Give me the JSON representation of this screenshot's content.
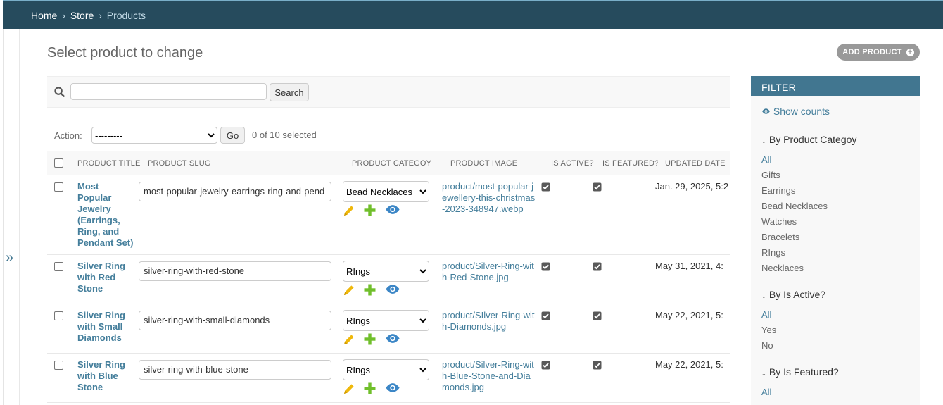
{
  "breadcrumbs": {
    "home": "Home",
    "sep1": "›",
    "store": "Store",
    "sep2": "›",
    "current": "Products"
  },
  "page": {
    "title": "Select product to change",
    "add_button": "ADD PRODUCT",
    "add_icon": "+"
  },
  "search": {
    "value": "",
    "placeholder": "",
    "button": "Search"
  },
  "actions": {
    "label": "Action:",
    "selected_option": "---------",
    "go": "Go",
    "selected_count": "0 of 10 selected"
  },
  "table": {
    "headers": {
      "title": "PRODUCT TITLE",
      "slug": "PRODUCT SLUG",
      "category": "PRODUCT CATEGOY",
      "image": "PRODUCT IMAGE",
      "active": "IS ACTIVE?",
      "featured": "IS FEATURED?",
      "updated": "UPDATED DATE"
    },
    "rows": [
      {
        "title": "Most Popular Jewelry (Earrings, Ring, and Pendant Set)",
        "slug": "most-popular-jewelry-earrings-ring-and-pend",
        "category": "Bead Necklaces",
        "image": "product/most-popular-jewellery-this-christmas-2023-348947.webp",
        "is_active": true,
        "is_featured": true,
        "updated": "Jan. 29, 2025, 5:2"
      },
      {
        "title": "Silver Ring with Red Stone",
        "slug": "silver-ring-with-red-stone",
        "category": "RIngs",
        "image": "product/Silver-Ring-with-Red-Stone.jpg",
        "is_active": true,
        "is_featured": true,
        "updated": "May 31, 2021, 4:"
      },
      {
        "title": "Silver Ring with Small Diamonds",
        "slug": "silver-ring-with-small-diamonds",
        "category": "RIngs",
        "image": "product/SIlver-Ring-with-Diamonds.jpg",
        "is_active": true,
        "is_featured": true,
        "updated": "May 22, 2021, 5:"
      },
      {
        "title": "Silver Ring with Blue Stone",
        "slug": "silver-ring-with-blue-stone",
        "category": "RIngs",
        "image": "product/Silver-Ring-with-Blue-Stone-and-Diamonds.jpg",
        "is_active": true,
        "is_featured": true,
        "updated": "May 22, 2021, 5:"
      }
    ]
  },
  "filter": {
    "title": "FILTER",
    "show_counts": "Show counts",
    "sections": [
      {
        "title": "↓ By Product Categoy",
        "items": [
          "All",
          "Gifts",
          "Earrings",
          "Bead Necklaces",
          "Watches",
          "Bracelets",
          "RIngs",
          "Necklaces"
        ]
      },
      {
        "title": "↓ By Is Active?",
        "items": [
          "All",
          "Yes",
          "No"
        ]
      },
      {
        "title": "↓ By Is Featured?",
        "items": [
          "All"
        ]
      }
    ]
  },
  "nav_toggle": "»",
  "colors": {
    "header": "#264b5d",
    "accent": "#417690",
    "link": "#447e9b",
    "edit": "#efb80b",
    "add": "#70bf2b",
    "view": "#3b86c6"
  }
}
